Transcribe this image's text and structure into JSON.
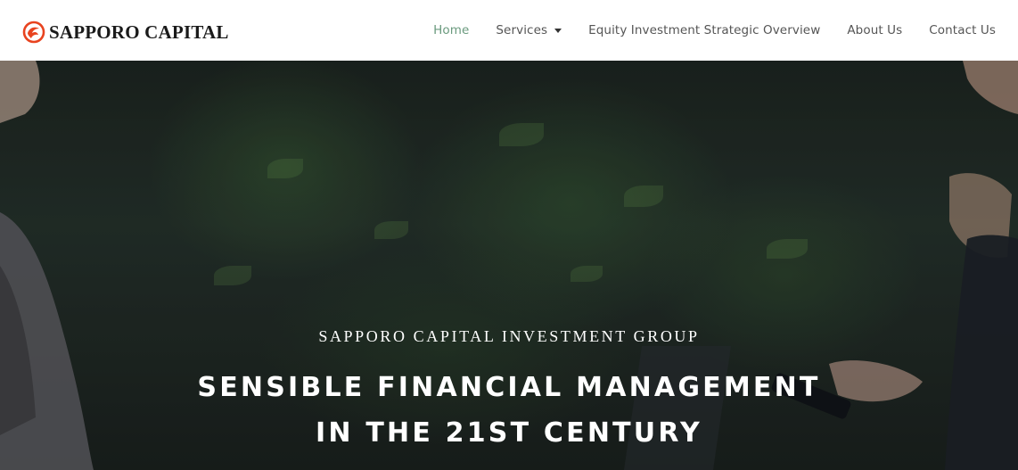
{
  "brand": {
    "name": "SAPPORO CAPITAL",
    "logo_icon": "phoenix-logo-icon",
    "accent_color": "#e8431f"
  },
  "nav": {
    "items": [
      {
        "label": "Home",
        "active": true
      },
      {
        "label": "Services",
        "has_dropdown": true
      },
      {
        "label": "Equity Investment Strategic Overview"
      },
      {
        "label": "About Us"
      },
      {
        "label": "Contact Us"
      }
    ],
    "active_color": "#6a9a7e",
    "dropdown_icon": "caret-down-icon"
  },
  "hero": {
    "eyebrow": "SAPPORO CAPITAL INVESTMENT GROUP",
    "headline_line1": "SENSIBLE FINANCIAL MANAGEMENT",
    "headline_line2": "IN THE 21ST CENTURY"
  }
}
